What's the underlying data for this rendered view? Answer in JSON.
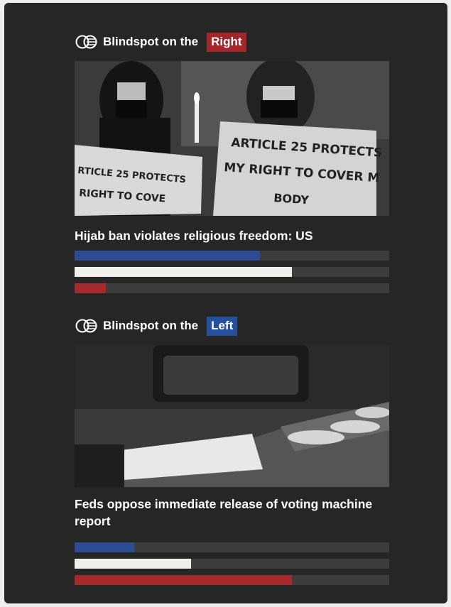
{
  "colors": {
    "card_background": "#262626",
    "right_tag": "#a3262a",
    "left_tag": "#24509e",
    "bar_left": "#2c4d93",
    "bar_center": "#f1efe9",
    "bar_right": "#a42a2c",
    "bar_track": "#3d3d3d"
  },
  "blindspots": [
    {
      "header_text": "Blindspot on the",
      "side_label": "Right",
      "icon": "blindspot-logo-icon",
      "image": {
        "description_icon": "protest-photo",
        "sign_left_lines": [
          "RTICLE 25 PROTECTS",
          "RIGHT TO COVE"
        ],
        "sign_right_lines": [
          "ARTICLE 25 PROTECTS",
          "MY RIGHT TO COVER M",
          "BODY"
        ]
      },
      "headline": "Hijab ban violates religious freedom: US",
      "bias_bars": {
        "left": 0.59,
        "center": 0.69,
        "right": 0.1
      }
    },
    {
      "header_text": "Blindspot on the",
      "side_label": "Left",
      "icon": "blindspot-logo-icon",
      "image": {
        "description_icon": "voting-machine-photo"
      },
      "headline": "Feds oppose immediate release of voting machine report",
      "bias_bars": {
        "left": 0.19,
        "center": 0.37,
        "right": 0.69
      }
    }
  ]
}
